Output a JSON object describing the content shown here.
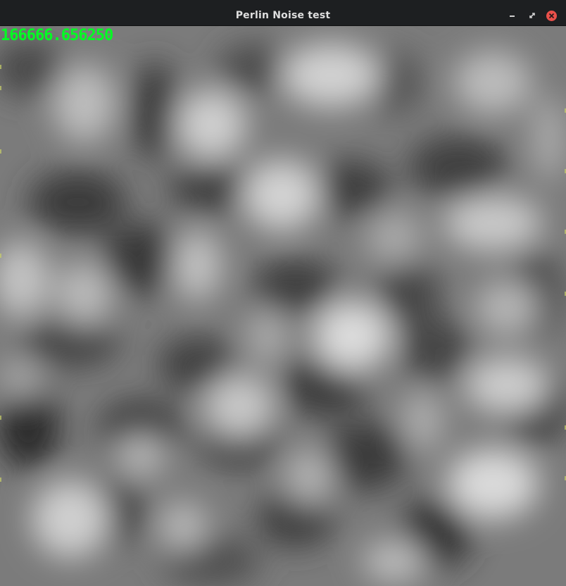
{
  "window": {
    "title": "Perlin Noise test",
    "controls": {
      "minimize": "minimize",
      "maximize": "maximize",
      "close": "close"
    }
  },
  "overlay": {
    "counter_text": "166666.656250",
    "counter_color": "#00ff22"
  },
  "colors": {
    "titlebar": "#1d1f21",
    "title_text": "#dfdfdf",
    "close_button": "#e9504a"
  },
  "icons": {
    "minimize": "minimize-icon",
    "maximize": "maximize-icon",
    "close": "close-icon"
  }
}
